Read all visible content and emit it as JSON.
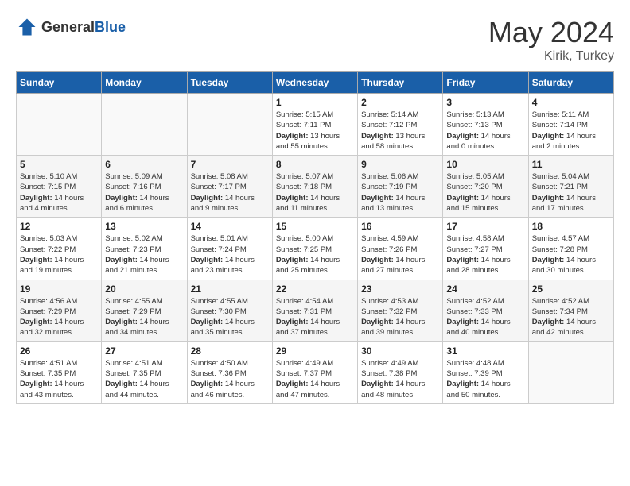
{
  "header": {
    "logo_general": "General",
    "logo_blue": "Blue",
    "month_title": "May 2024",
    "location": "Kirik, Turkey"
  },
  "weekdays": [
    "Sunday",
    "Monday",
    "Tuesday",
    "Wednesday",
    "Thursday",
    "Friday",
    "Saturday"
  ],
  "weeks": [
    [
      {
        "day": "",
        "info": ""
      },
      {
        "day": "",
        "info": ""
      },
      {
        "day": "",
        "info": ""
      },
      {
        "day": "1",
        "info": "Sunrise: 5:15 AM\nSunset: 7:11 PM\nDaylight: 13 hours and 55 minutes."
      },
      {
        "day": "2",
        "info": "Sunrise: 5:14 AM\nSunset: 7:12 PM\nDaylight: 13 hours and 58 minutes."
      },
      {
        "day": "3",
        "info": "Sunrise: 5:13 AM\nSunset: 7:13 PM\nDaylight: 14 hours and 0 minutes."
      },
      {
        "day": "4",
        "info": "Sunrise: 5:11 AM\nSunset: 7:14 PM\nDaylight: 14 hours and 2 minutes."
      }
    ],
    [
      {
        "day": "5",
        "info": "Sunrise: 5:10 AM\nSunset: 7:15 PM\nDaylight: 14 hours and 4 minutes."
      },
      {
        "day": "6",
        "info": "Sunrise: 5:09 AM\nSunset: 7:16 PM\nDaylight: 14 hours and 6 minutes."
      },
      {
        "day": "7",
        "info": "Sunrise: 5:08 AM\nSunset: 7:17 PM\nDaylight: 14 hours and 9 minutes."
      },
      {
        "day": "8",
        "info": "Sunrise: 5:07 AM\nSunset: 7:18 PM\nDaylight: 14 hours and 11 minutes."
      },
      {
        "day": "9",
        "info": "Sunrise: 5:06 AM\nSunset: 7:19 PM\nDaylight: 14 hours and 13 minutes."
      },
      {
        "day": "10",
        "info": "Sunrise: 5:05 AM\nSunset: 7:20 PM\nDaylight: 14 hours and 15 minutes."
      },
      {
        "day": "11",
        "info": "Sunrise: 5:04 AM\nSunset: 7:21 PM\nDaylight: 14 hours and 17 minutes."
      }
    ],
    [
      {
        "day": "12",
        "info": "Sunrise: 5:03 AM\nSunset: 7:22 PM\nDaylight: 14 hours and 19 minutes."
      },
      {
        "day": "13",
        "info": "Sunrise: 5:02 AM\nSunset: 7:23 PM\nDaylight: 14 hours and 21 minutes."
      },
      {
        "day": "14",
        "info": "Sunrise: 5:01 AM\nSunset: 7:24 PM\nDaylight: 14 hours and 23 minutes."
      },
      {
        "day": "15",
        "info": "Sunrise: 5:00 AM\nSunset: 7:25 PM\nDaylight: 14 hours and 25 minutes."
      },
      {
        "day": "16",
        "info": "Sunrise: 4:59 AM\nSunset: 7:26 PM\nDaylight: 14 hours and 27 minutes."
      },
      {
        "day": "17",
        "info": "Sunrise: 4:58 AM\nSunset: 7:27 PM\nDaylight: 14 hours and 28 minutes."
      },
      {
        "day": "18",
        "info": "Sunrise: 4:57 AM\nSunset: 7:28 PM\nDaylight: 14 hours and 30 minutes."
      }
    ],
    [
      {
        "day": "19",
        "info": "Sunrise: 4:56 AM\nSunset: 7:29 PM\nDaylight: 14 hours and 32 minutes."
      },
      {
        "day": "20",
        "info": "Sunrise: 4:55 AM\nSunset: 7:29 PM\nDaylight: 14 hours and 34 minutes."
      },
      {
        "day": "21",
        "info": "Sunrise: 4:55 AM\nSunset: 7:30 PM\nDaylight: 14 hours and 35 minutes."
      },
      {
        "day": "22",
        "info": "Sunrise: 4:54 AM\nSunset: 7:31 PM\nDaylight: 14 hours and 37 minutes."
      },
      {
        "day": "23",
        "info": "Sunrise: 4:53 AM\nSunset: 7:32 PM\nDaylight: 14 hours and 39 minutes."
      },
      {
        "day": "24",
        "info": "Sunrise: 4:52 AM\nSunset: 7:33 PM\nDaylight: 14 hours and 40 minutes."
      },
      {
        "day": "25",
        "info": "Sunrise: 4:52 AM\nSunset: 7:34 PM\nDaylight: 14 hours and 42 minutes."
      }
    ],
    [
      {
        "day": "26",
        "info": "Sunrise: 4:51 AM\nSunset: 7:35 PM\nDaylight: 14 hours and 43 minutes."
      },
      {
        "day": "27",
        "info": "Sunrise: 4:51 AM\nSunset: 7:35 PM\nDaylight: 14 hours and 44 minutes."
      },
      {
        "day": "28",
        "info": "Sunrise: 4:50 AM\nSunset: 7:36 PM\nDaylight: 14 hours and 46 minutes."
      },
      {
        "day": "29",
        "info": "Sunrise: 4:49 AM\nSunset: 7:37 PM\nDaylight: 14 hours and 47 minutes."
      },
      {
        "day": "30",
        "info": "Sunrise: 4:49 AM\nSunset: 7:38 PM\nDaylight: 14 hours and 48 minutes."
      },
      {
        "day": "31",
        "info": "Sunrise: 4:48 AM\nSunset: 7:39 PM\nDaylight: 14 hours and 50 minutes."
      },
      {
        "day": "",
        "info": ""
      }
    ]
  ]
}
